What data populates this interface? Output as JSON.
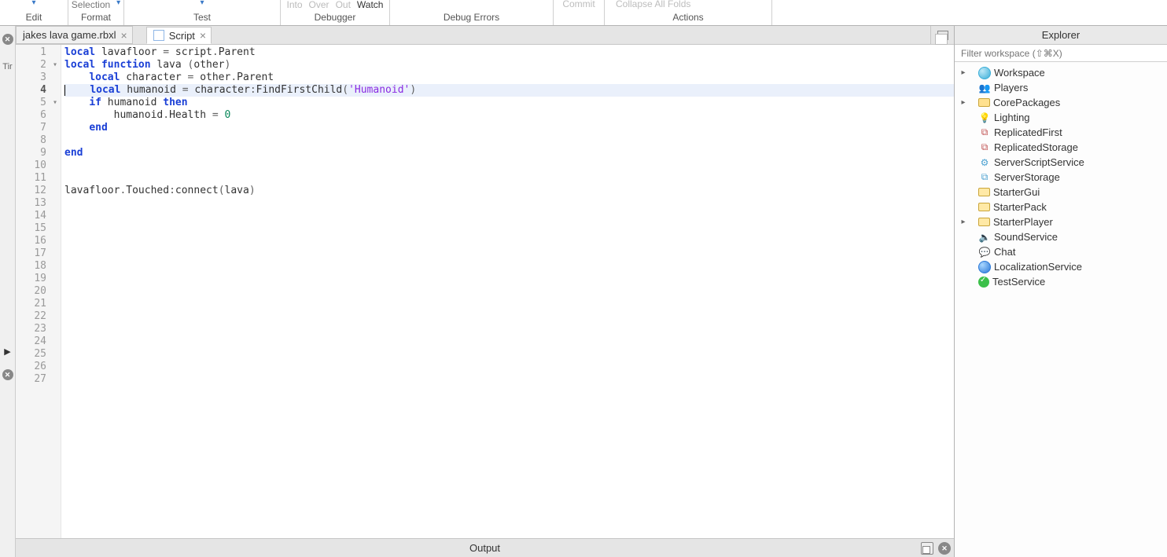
{
  "ribbon": {
    "edit": {
      "label": "Edit"
    },
    "format": {
      "label": "Format",
      "top": "Selection"
    },
    "test": {
      "label": "Test"
    },
    "debugger": {
      "label": "Debugger",
      "items": {
        "into": "Into",
        "over": "Over",
        "out": "Out",
        "watch": "Watch"
      }
    },
    "debug_errors": {
      "label": "Debug Errors"
    },
    "commit": {
      "label": "Commit"
    },
    "actions": {
      "label": "Actions",
      "collapse_all": "Collapse All Folds"
    }
  },
  "tabs": {
    "file_tab_label": "jakes lava game.rbxl",
    "script_tab_label": "Script"
  },
  "leftstrip": {
    "tin_label": "Tir"
  },
  "editor": {
    "current_line": 4,
    "total_visible_lines": 27,
    "fold_lines": [
      2,
      5
    ],
    "code": [
      {
        "n": 1,
        "indent": 0,
        "tokens": [
          {
            "t": "local",
            "c": "k-keyword"
          },
          {
            "t": " lavafloor ",
            "c": "k-ident"
          },
          {
            "t": "=",
            "c": "k-punc"
          },
          {
            "t": " script",
            "c": "k-ident"
          },
          {
            "t": ".",
            "c": "k-punc"
          },
          {
            "t": "Parent",
            "c": "k-ident"
          }
        ]
      },
      {
        "n": 2,
        "indent": 0,
        "tokens": [
          {
            "t": "local function",
            "c": "k-keyword"
          },
          {
            "t": " lava ",
            "c": "k-ident"
          },
          {
            "t": "(",
            "c": "k-punc"
          },
          {
            "t": "other",
            "c": "k-ident"
          },
          {
            "t": ")",
            "c": "k-punc"
          }
        ]
      },
      {
        "n": 3,
        "indent": 1,
        "tokens": [
          {
            "t": "local",
            "c": "k-keyword"
          },
          {
            "t": " character ",
            "c": "k-ident"
          },
          {
            "t": "=",
            "c": "k-punc"
          },
          {
            "t": " other",
            "c": "k-ident"
          },
          {
            "t": ".",
            "c": "k-punc"
          },
          {
            "t": "Parent",
            "c": "k-ident"
          }
        ]
      },
      {
        "n": 4,
        "indent": 1,
        "current": true,
        "caret_at_start": true,
        "tokens": [
          {
            "t": "local",
            "c": "k-keyword"
          },
          {
            "t": " humanoid ",
            "c": "k-ident"
          },
          {
            "t": "=",
            "c": "k-punc"
          },
          {
            "t": " character",
            "c": "k-ident"
          },
          {
            "t": ":",
            "c": "k-punc"
          },
          {
            "t": "FindFirstChild",
            "c": "k-ident"
          },
          {
            "t": "(",
            "c": "k-punc"
          },
          {
            "t": "'Humanoid'",
            "c": "k-string"
          },
          {
            "t": ")",
            "c": "k-punc"
          }
        ]
      },
      {
        "n": 5,
        "indent": 1,
        "tokens": [
          {
            "t": "if",
            "c": "k-keyword"
          },
          {
            "t": " humanoid ",
            "c": "k-ident"
          },
          {
            "t": "then",
            "c": "k-keyword"
          }
        ]
      },
      {
        "n": 6,
        "indent": 2,
        "tokens": [
          {
            "t": "humanoid",
            "c": "k-ident"
          },
          {
            "t": ".",
            "c": "k-punc"
          },
          {
            "t": "Health ",
            "c": "k-ident"
          },
          {
            "t": "=",
            "c": "k-punc"
          },
          {
            "t": " ",
            "c": "k-ident"
          },
          {
            "t": "0",
            "c": "k-num"
          }
        ]
      },
      {
        "n": 7,
        "indent": 1,
        "tokens": [
          {
            "t": "end",
            "c": "k-keyword"
          }
        ]
      },
      {
        "n": 8,
        "indent": 0,
        "tokens": []
      },
      {
        "n": 9,
        "indent": 0,
        "tokens": [
          {
            "t": "end",
            "c": "k-keyword"
          }
        ]
      },
      {
        "n": 10,
        "indent": 0,
        "tokens": []
      },
      {
        "n": 11,
        "indent": 0,
        "tokens": []
      },
      {
        "n": 12,
        "indent": 0,
        "tokens": [
          {
            "t": "lavafloor",
            "c": "k-ident"
          },
          {
            "t": ".",
            "c": "k-punc"
          },
          {
            "t": "Touched",
            "c": "k-ident"
          },
          {
            "t": ":",
            "c": "k-punc"
          },
          {
            "t": "connect",
            "c": "k-ident"
          },
          {
            "t": "(",
            "c": "k-punc"
          },
          {
            "t": "lava",
            "c": "k-ident"
          },
          {
            "t": ")",
            "c": "k-punc"
          }
        ]
      }
    ]
  },
  "output": {
    "title": "Output"
  },
  "explorer": {
    "title": "Explorer",
    "filter_placeholder": "Filter workspace (⇧⌘X)",
    "nodes": [
      {
        "label": "Workspace",
        "icon": "ic-ws",
        "expand": true
      },
      {
        "label": "Players",
        "icon": "ic-players",
        "glyph": "👥",
        "expand": false
      },
      {
        "label": "CorePackages",
        "icon": "ic-folder",
        "expand": true
      },
      {
        "label": "Lighting",
        "icon": "ic-light",
        "glyph": "💡",
        "expand": false
      },
      {
        "label": "ReplicatedFirst",
        "icon": "ic-repfirst",
        "glyph": "⧉",
        "expand": false
      },
      {
        "label": "ReplicatedStorage",
        "icon": "ic-repstore",
        "glyph": "⧉",
        "expand": false
      },
      {
        "label": "ServerScriptService",
        "icon": "ic-sss",
        "glyph": "⚙",
        "expand": false
      },
      {
        "label": "ServerStorage",
        "icon": "ic-sstor",
        "glyph": "⧉",
        "expand": false
      },
      {
        "label": "StarterGui",
        "icon": "ic-gui",
        "expand": false
      },
      {
        "label": "StarterPack",
        "icon": "ic-gui",
        "expand": false
      },
      {
        "label": "StarterPlayer",
        "icon": "ic-gui",
        "expand": true
      },
      {
        "label": "SoundService",
        "icon": "ic-sounds",
        "glyph": "🔈",
        "expand": false
      },
      {
        "label": "Chat",
        "icon": "ic-chat",
        "glyph": "💬",
        "expand": false
      },
      {
        "label": "LocalizationService",
        "icon": "ic-locale",
        "expand": false
      },
      {
        "label": "TestService",
        "icon": "ic-test",
        "expand": false
      }
    ]
  }
}
